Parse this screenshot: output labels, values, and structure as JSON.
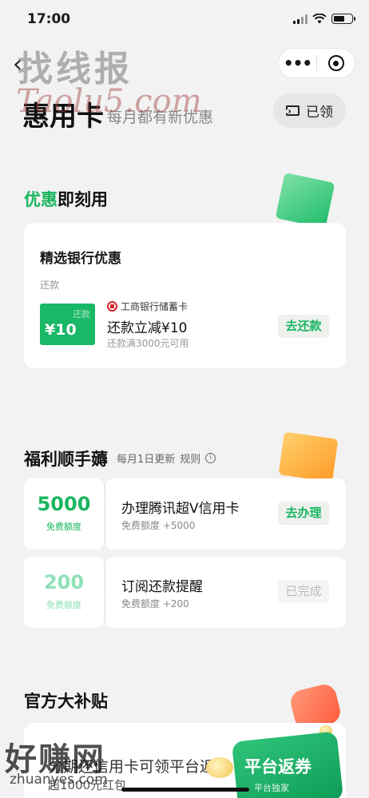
{
  "status": {
    "time": "17:00"
  },
  "watermarks": {
    "top_cn": "找线报",
    "top_url": "Taolu5.com",
    "bottom_cn": "好赚网",
    "bottom_url": "zhuanyes.com"
  },
  "header": {
    "title": "惠用卡",
    "subtitle": "每月都有新优惠",
    "claimed_label": "已领",
    "capsule_more": "•••"
  },
  "section_instant": {
    "title_highlight": "优惠",
    "title_rest": "即刻用",
    "card": {
      "title": "精选银行优惠",
      "category": "还款",
      "coupon_tag": "还款",
      "coupon_amount": "¥10",
      "bank": "工商银行储蓄卡",
      "offer": "还款立减¥10",
      "condition": "还款满3000元可用",
      "action": "去还款"
    }
  },
  "section_welfare": {
    "title": "福利顺手薅",
    "subtitle": "每月1日更新",
    "rules_label": "规则",
    "items": [
      {
        "amount": "5000",
        "unit": "免费额度",
        "name": "办理腾讯超V信用卡",
        "bonus": "免费额度 +5000",
        "action": "去办理"
      },
      {
        "amount": "200",
        "unit": "免费额度",
        "name": "订阅还款提醒",
        "bonus": "免费额度 +200",
        "action": "已完成"
      }
    ]
  },
  "section_subsidy": {
    "title": "官方大补贴",
    "card_line1": "分期还信用卡可领平台返券",
    "card_line2": "超1000元红包",
    "badge_title": "平台返券",
    "badge_sub": "平台独家"
  },
  "colors": {
    "accent": "#19b55f",
    "background": "#f2f2f2"
  }
}
